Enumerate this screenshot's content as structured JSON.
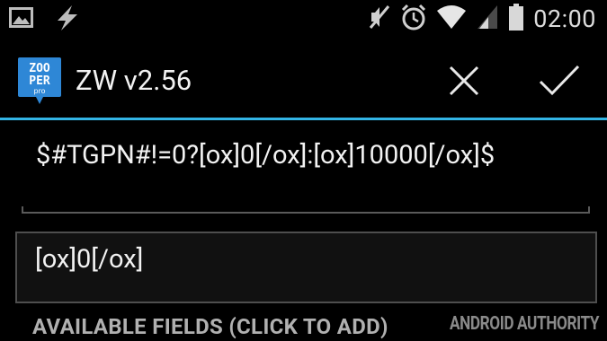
{
  "status_bar": {
    "time": "02:00",
    "icons": [
      "image-notification-icon",
      "flash-notification-icon",
      "mute-icon",
      "alarm-icon",
      "wifi-icon",
      "signal-icon",
      "battery-icon"
    ]
  },
  "app": {
    "logo_name": "zooper-pro-logo",
    "title": "ZW v2.56",
    "accent_color": "#33b5e5"
  },
  "editor": {
    "formula": "$#TGPN#!=0?[ox]0[/ox]:[ox]10000[/ox]$",
    "preview": "[ox]0[/ox]"
  },
  "section": {
    "available_fields_label": "AVAILABLE FIELDS (CLICK TO ADD)"
  },
  "watermark": "ANDROID AUTHORITY"
}
